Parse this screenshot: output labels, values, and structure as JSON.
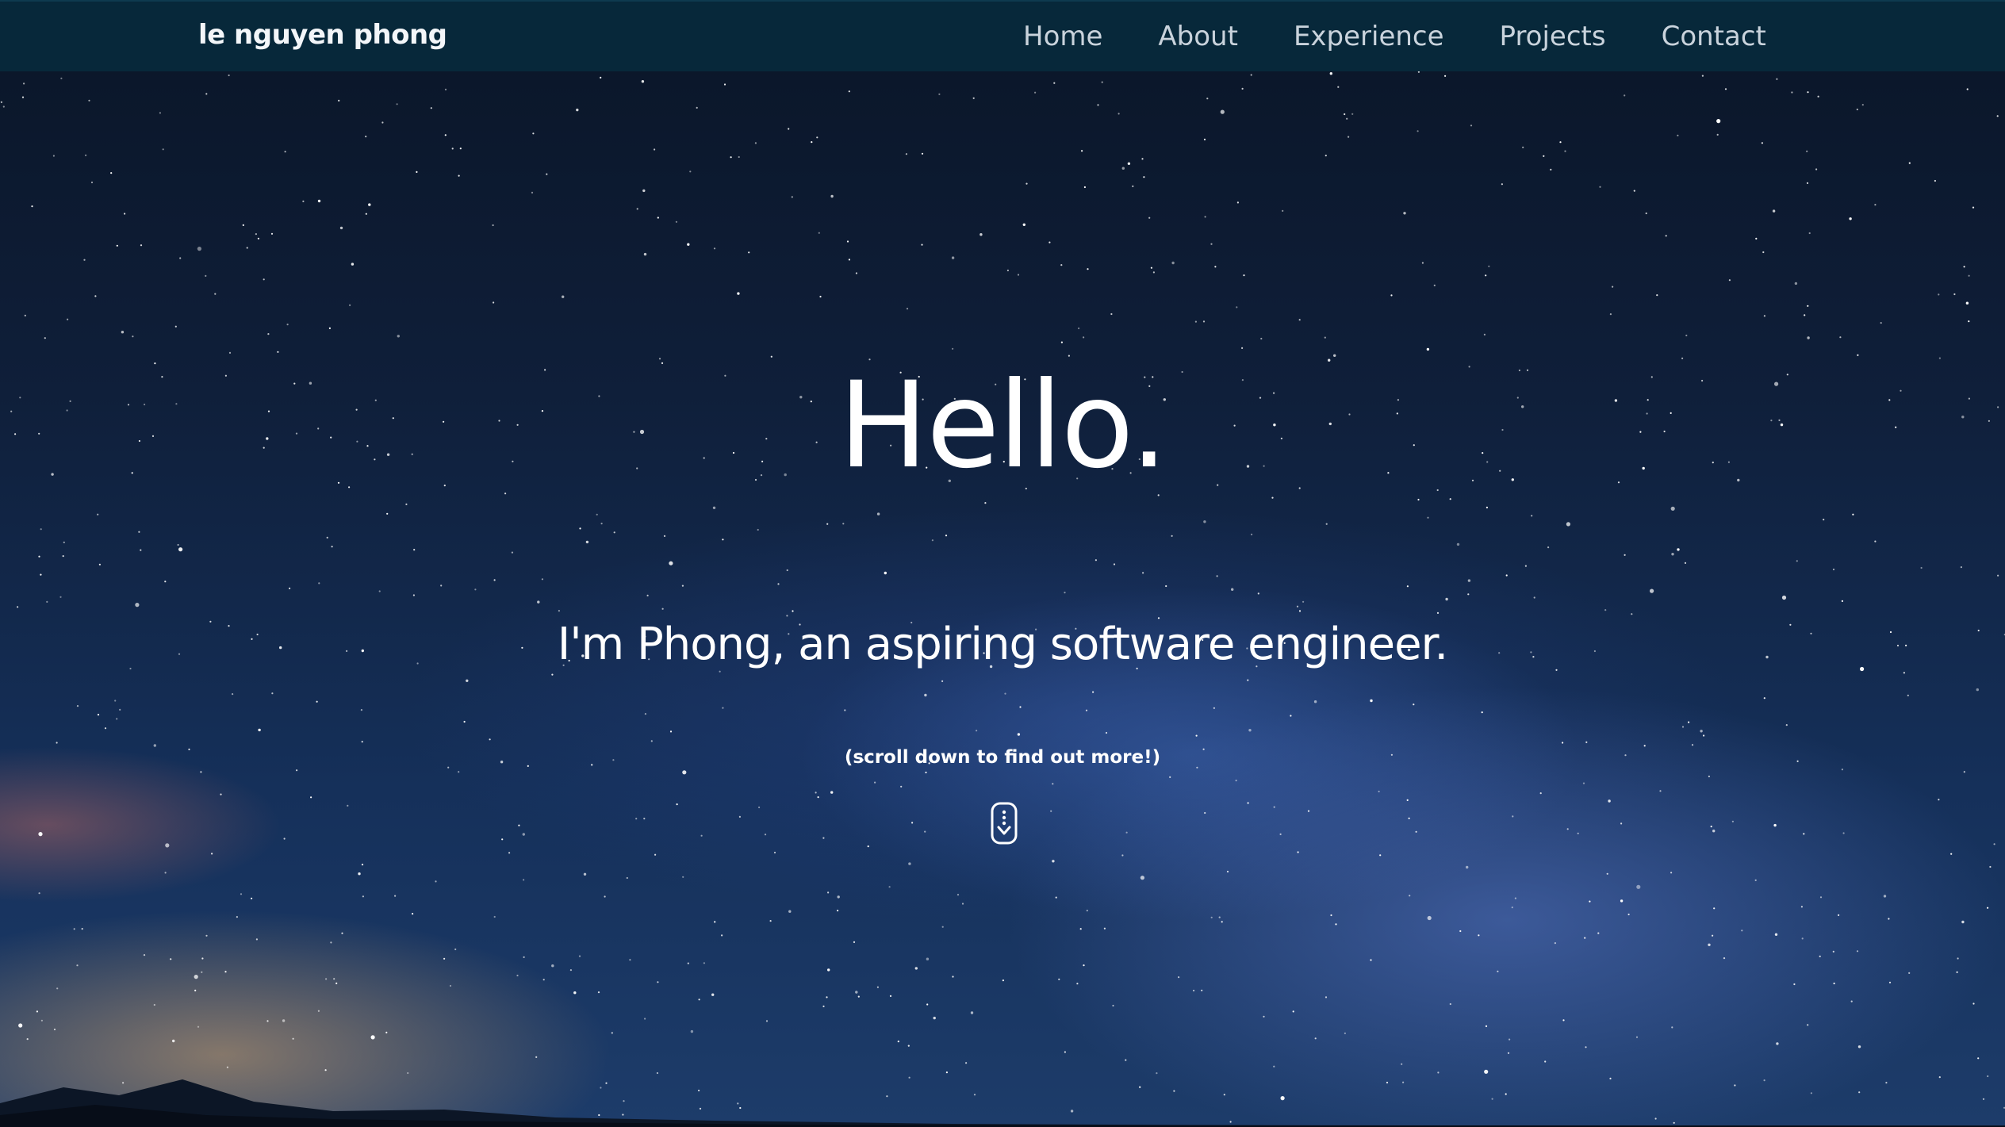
{
  "navbar": {
    "brand": "le nguyen phong",
    "links": [
      "Home",
      "About",
      "Experience",
      "Projects",
      "Contact"
    ]
  },
  "hero": {
    "title": "Hello.",
    "subtitle": "I'm Phong, an aspiring software engineer.",
    "hint": "(scroll down to find out more!)",
    "scroll_icon": "mouse-scroll-down-icon"
  },
  "colors": {
    "navbar_bg": "#07283a",
    "nav_link": "#c9d3dc",
    "hero_text": "#ffffff",
    "sky_top": "#0a1527",
    "sky_bottom": "#1d3c6a"
  }
}
